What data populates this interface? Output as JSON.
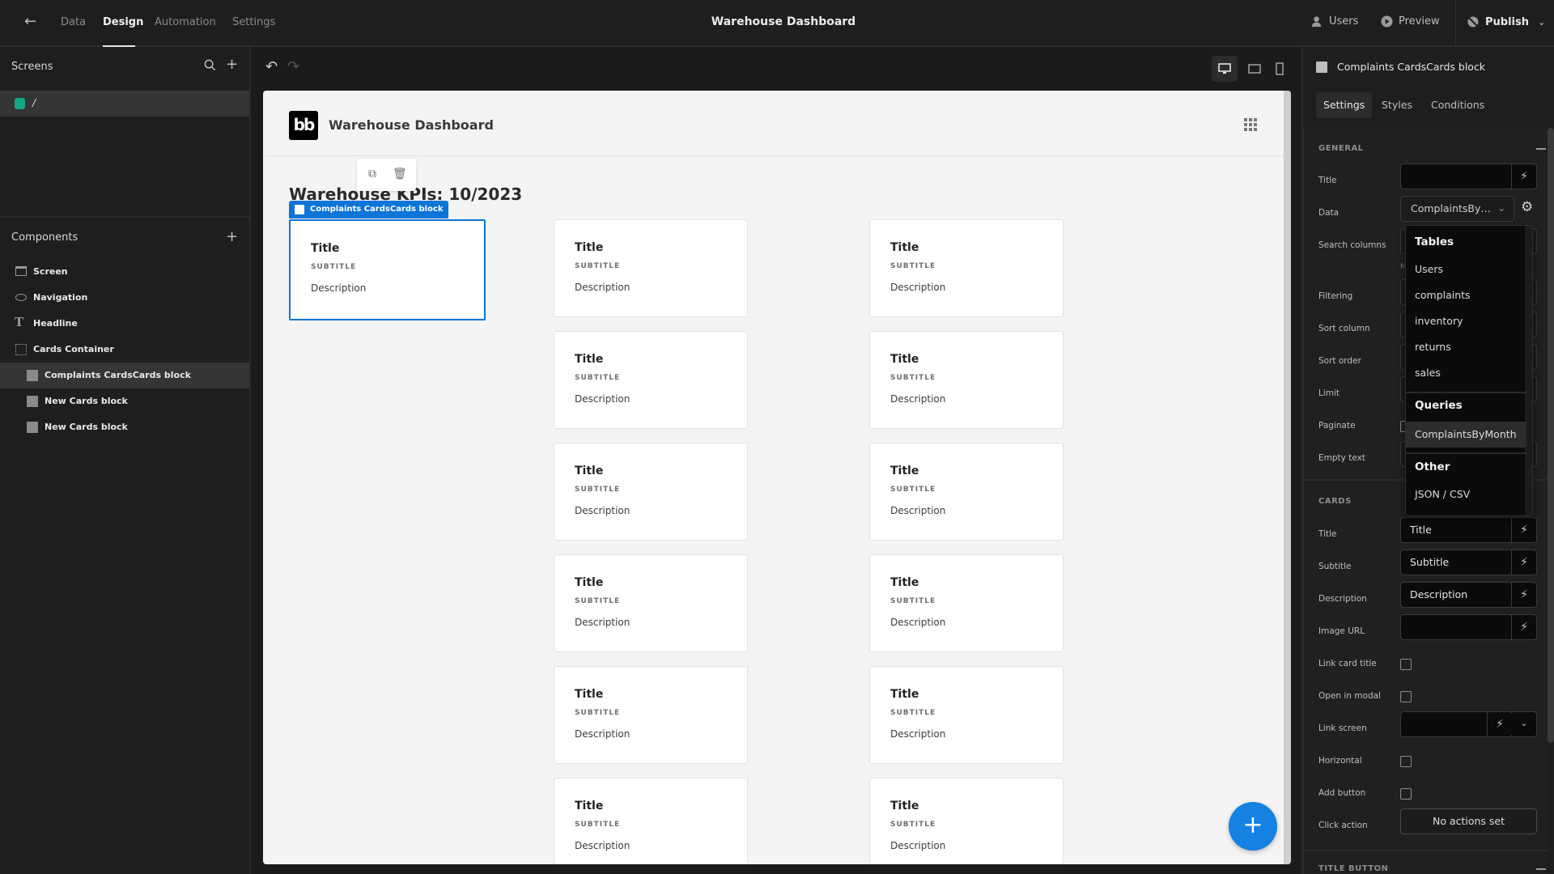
{
  "topbar": {
    "back_icon": "arrow-left-icon",
    "tabs": [
      {
        "label": "Data",
        "active": false
      },
      {
        "label": "Design",
        "active": true
      },
      {
        "label": "Automation",
        "active": false
      },
      {
        "label": "Settings",
        "active": false
      }
    ],
    "title": "Warehouse Dashboard",
    "users_label": "Users",
    "preview_label": "Preview",
    "publish_label": "Publish"
  },
  "screens_panel": {
    "title": "Screens",
    "screens": [
      {
        "route": "/",
        "color": "#12a886",
        "selected": true
      }
    ]
  },
  "components_panel": {
    "title": "Components",
    "items": [
      {
        "label": "Screen",
        "icon": "screen-icon",
        "selected": false
      },
      {
        "label": "Navigation",
        "icon": "eye-icon",
        "selected": false
      },
      {
        "label": "Headline",
        "icon": "text-icon",
        "selected": false
      },
      {
        "label": "Cards Container",
        "icon": "container-icon",
        "selected": false
      },
      {
        "label": "Complaints CardsCards block",
        "icon": "cards-block-icon",
        "selected": true
      },
      {
        "label": "New Cards block",
        "icon": "cards-block-icon",
        "selected": false
      },
      {
        "label": "New Cards block",
        "icon": "cards-block-icon",
        "selected": false
      }
    ]
  },
  "canvas": {
    "app_name": "Warehouse Dashboard",
    "logo_text": "bb",
    "headline": "Warehouse KPIs: 10/2023",
    "selection_label": "Complaints CardsCards block",
    "card_template": {
      "title": "Title",
      "subtitle": "SUBTITLE",
      "description": "Description"
    },
    "columns": [
      {
        "rows": 1,
        "selected_first": true
      },
      {
        "rows": 6,
        "selected_first": false
      },
      {
        "rows": 6,
        "selected_first": false
      }
    ],
    "fab_label": "+"
  },
  "settings_panel": {
    "component_name": "Complaints CardsCards block",
    "tabs": [
      {
        "label": "Settings",
        "active": true
      },
      {
        "label": "Styles",
        "active": false
      },
      {
        "label": "Conditions",
        "active": false
      }
    ],
    "general": {
      "title": "GENERAL",
      "labels": {
        "title": "Title",
        "data": "Data",
        "search_columns": "Search columns",
        "filtering": "Filtering",
        "sort_column": "Sort column",
        "sort_order": "Sort order",
        "limit": "Limit",
        "paginate": "Paginate",
        "empty_text": "Empty text"
      },
      "title_value": "",
      "data_value": "ComplaintsBy…",
      "hint_fragment": "M"
    },
    "cards": {
      "title": "CARDS",
      "labels": {
        "title": "Title",
        "subtitle": "Subtitle",
        "description": "Description",
        "image_url": "Image URL",
        "link_card_title": "Link card title",
        "open_in_modal": "Open in modal",
        "link_screen": "Link screen",
        "horizontal": "Horizontal",
        "add_button": "Add button",
        "click_action": "Click action"
      },
      "title_value": "Title",
      "subtitle_value": "Subtitle",
      "description_value": "Description",
      "image_url_value": "",
      "link_screen_value": "",
      "link_card_title_checked": false,
      "open_in_modal_checked": false,
      "horizontal_checked": false,
      "add_button_checked": false,
      "click_action_label": "No actions set"
    },
    "title_button": {
      "title": "TITLE BUTTON"
    }
  },
  "data_dropdown": {
    "groups": [
      {
        "heading": "Tables",
        "items": [
          "Users",
          "complaints",
          "inventory",
          "returns",
          "sales"
        ]
      },
      {
        "heading": "Queries",
        "items": [
          "ComplaintsByMonth"
        ]
      },
      {
        "heading": "Other",
        "items": [
          "JSON / CSV"
        ]
      }
    ],
    "hovered": "ComplaintsByMonth"
  }
}
